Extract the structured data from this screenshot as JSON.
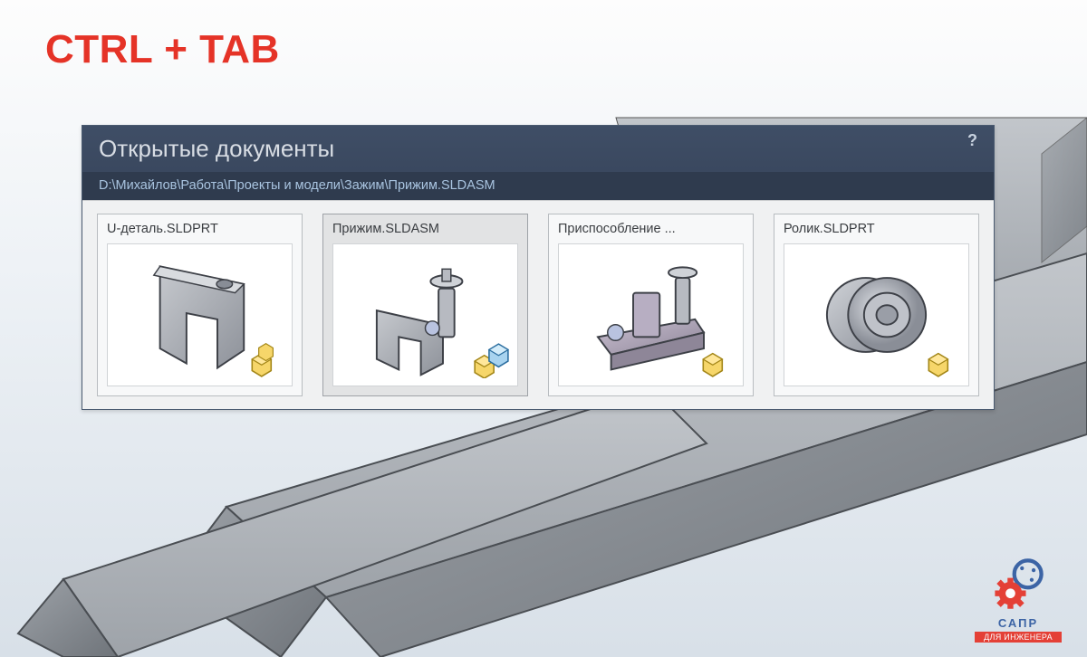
{
  "headline": "CTRL + TAB",
  "dialog": {
    "title": "Открытые документы",
    "path": "D:\\Михайлов\\Работа\\Проекты и модели\\Зажим\\Прижим.SLDASM",
    "help": "?"
  },
  "documents": [
    {
      "label": "U-деталь.SLDPRT",
      "type": "part",
      "selected": false
    },
    {
      "label": "Прижим.SLDASM",
      "type": "assembly",
      "selected": true
    },
    {
      "label": "Приспособление ...",
      "type": "part",
      "selected": false
    },
    {
      "label": "Ролик.SLDPRT",
      "type": "part",
      "selected": false
    }
  ],
  "watermark": {
    "line1": "САПР",
    "line2": "ДЛЯ ИНЖЕНЕРА"
  }
}
